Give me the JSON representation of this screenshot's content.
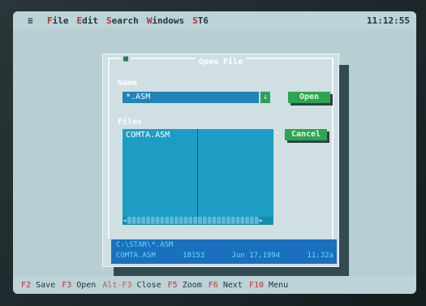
{
  "menubar": {
    "system_glyph": "≡",
    "items": [
      {
        "hotkey": "F",
        "rest": "ile"
      },
      {
        "hotkey": "E",
        "rest": "dit"
      },
      {
        "hotkey": "S",
        "rest": "earch"
      },
      {
        "hotkey": "W",
        "rest": "indows"
      },
      {
        "hotkey": "S",
        "rest": "T6"
      }
    ],
    "clock": "11:12:55"
  },
  "dialog": {
    "title": "Open File",
    "close_glyph": "■",
    "name_label_hotkey": "N",
    "name_label_rest": "ame",
    "name_value": "*.ASM",
    "history_glyph": "↓",
    "open_label": "Open",
    "files_label_hotkey": "F",
    "files_label_rest": "iles",
    "cancel_label": "Cancel",
    "cancel_marker": "·",
    "files": [
      "COMTA.ASM"
    ],
    "scrollbar_track": "◄▒▒▒▒▒▒▒▒▒▒▒▒▒▒▒▒▒▒▒▒▒▒▒▒▒▒▒▒►",
    "info": {
      "path": "C:\\STAR\\*.ASM",
      "file_name": "COMTA.ASM",
      "file_size": "18153",
      "file_date": "Jun 17,1994",
      "file_time": "11:32a"
    }
  },
  "statusbar": {
    "items": [
      {
        "key": "F2",
        "label": "Save"
      },
      {
        "key": "F3",
        "label": "Open"
      },
      {
        "key": "Alt-F3",
        "label": "Close"
      },
      {
        "key": "F5",
        "label": "Zoom"
      },
      {
        "key": "F6",
        "label": "Next"
      },
      {
        "key": "F10",
        "label": "Menu"
      }
    ]
  },
  "colors": {
    "desktop": "#b7cfd3",
    "dialog": "#cfdfe2",
    "list": "#1d9dc4",
    "button": "#2da44f",
    "info_panel": "#1a6fbf",
    "hotkey": "#c2362c"
  }
}
